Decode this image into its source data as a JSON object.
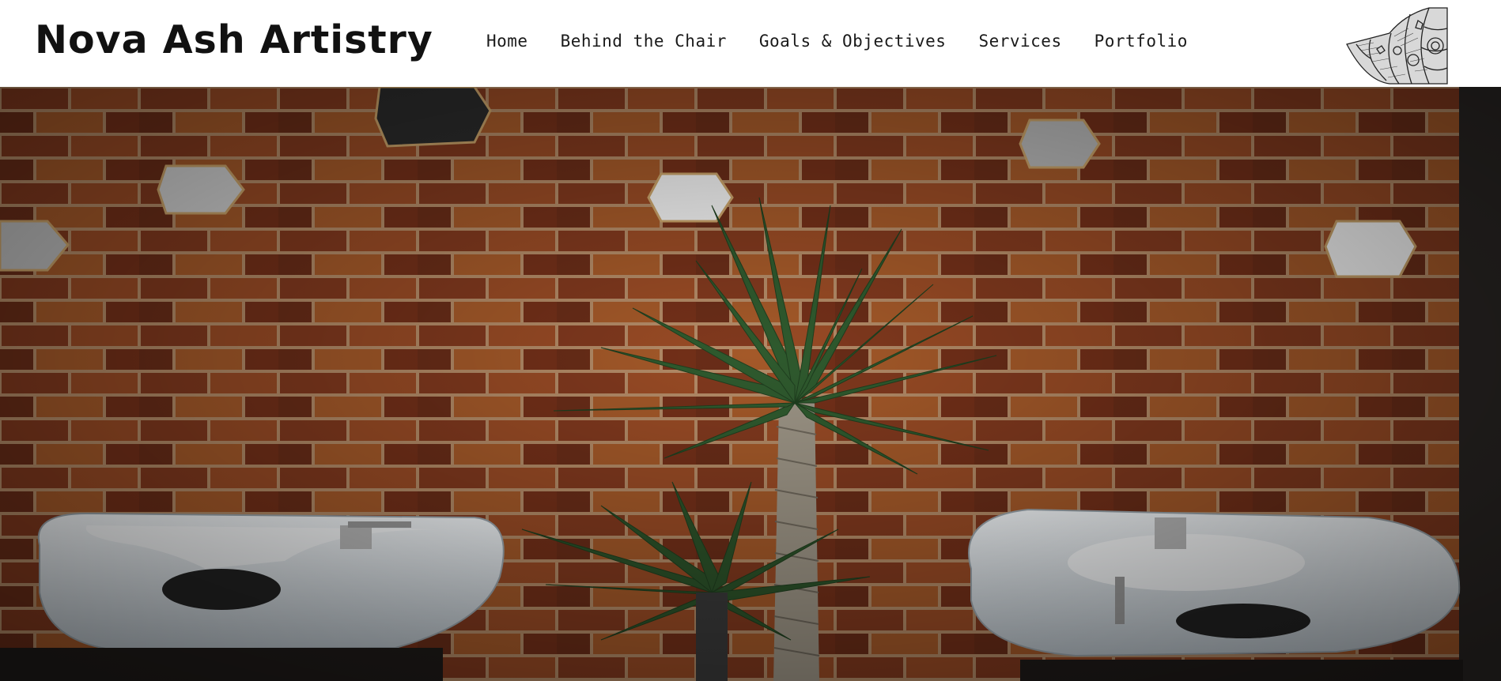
{
  "site": {
    "brand_name": "Nova Ash Artistry",
    "logo_icon": "lotus-mandala-icon"
  },
  "nav": {
    "items": [
      {
        "label": "Home",
        "name": "nav-item-home"
      },
      {
        "label": "Behind the Chair",
        "name": "nav-item-behind-the-chair"
      },
      {
        "label": "Goals & Objectives",
        "name": "nav-item-goals-objectives"
      },
      {
        "label": "Services",
        "name": "nav-item-services"
      },
      {
        "label": "Portfolio",
        "name": "nav-item-portfolio"
      }
    ]
  },
  "hero": {
    "image": "salon-interior-photo",
    "colors": {
      "brick_dark": "#5e2a18",
      "brick_mid": "#8a3e22",
      "brick_light": "#b5652f",
      "mortar": "#c9a27a",
      "basin": "#e9eef2",
      "plant": "#2f5a2e"
    }
  }
}
